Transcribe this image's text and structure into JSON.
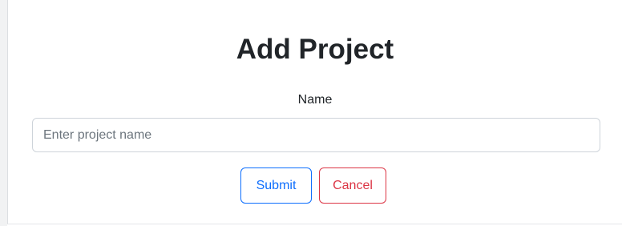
{
  "form": {
    "title": "Add Project",
    "name_label": "Name",
    "name_value": "",
    "name_placeholder": "Enter project name",
    "submit_label": "Submit",
    "cancel_label": "Cancel"
  },
  "colors": {
    "text": "#212529",
    "placeholder": "#6c757d",
    "input_border": "#ced4da",
    "submit": "#0d6efd",
    "cancel": "#dc3545"
  }
}
